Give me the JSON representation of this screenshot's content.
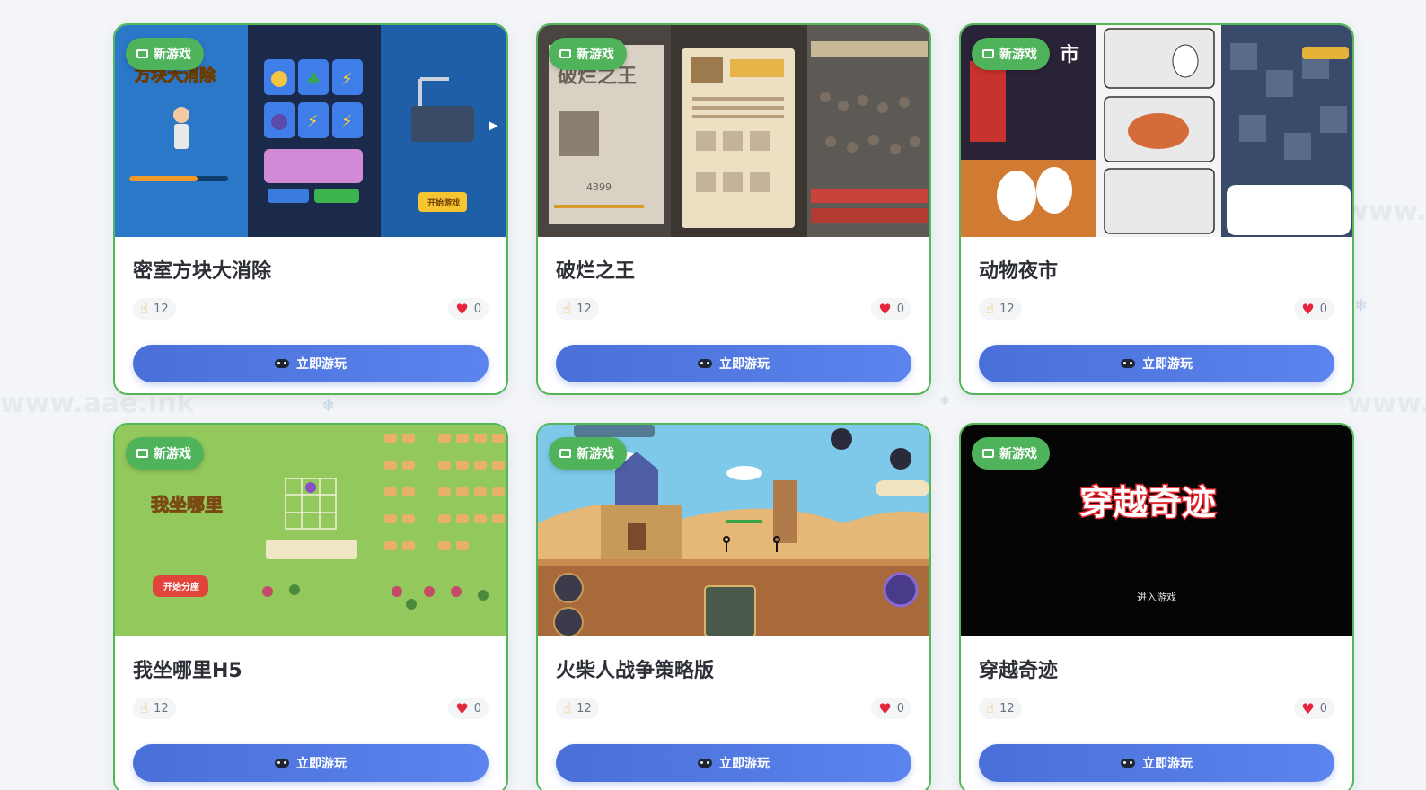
{
  "games": [
    {
      "title": "密室方块大消除",
      "badge": "新游戏",
      "plays": "12",
      "likes": "0",
      "play_label": "立即游玩",
      "art": {
        "splash_title": "方块大消除",
        "start": "开始游戏"
      }
    },
    {
      "title": "破烂之王",
      "badge": "新游戏",
      "plays": "12",
      "likes": "0",
      "play_label": "立即游玩",
      "art": {
        "splash_title": "破烂之王",
        "price": "4399"
      }
    },
    {
      "title": "动物夜市",
      "badge": "新游戏",
      "plays": "12",
      "likes": "0",
      "play_label": "立即游玩",
      "art": {
        "sign": "市"
      }
    },
    {
      "title": "我坐哪里H5",
      "badge": "新游戏",
      "plays": "12",
      "likes": "0",
      "play_label": "立即游玩",
      "art": {
        "splash_title": "我坐哪里",
        "start": "开始分座"
      }
    },
    {
      "title": "火柴人战争策略版",
      "badge": "新游戏",
      "plays": "12",
      "likes": "0",
      "play_label": "立即游玩",
      "art": {}
    },
    {
      "title": "穿越奇迹",
      "badge": "新游戏",
      "plays": "12",
      "likes": "0",
      "play_label": "立即游玩",
      "art": {
        "splash_title": "穿越奇迹",
        "enter": "进入游戏"
      }
    }
  ],
  "watermark": "www.aae.ink",
  "colors": {
    "card_border": "#53b75a",
    "badge": "#4fb35c",
    "button": "#4a6fd8",
    "heart": "#e3263b"
  }
}
